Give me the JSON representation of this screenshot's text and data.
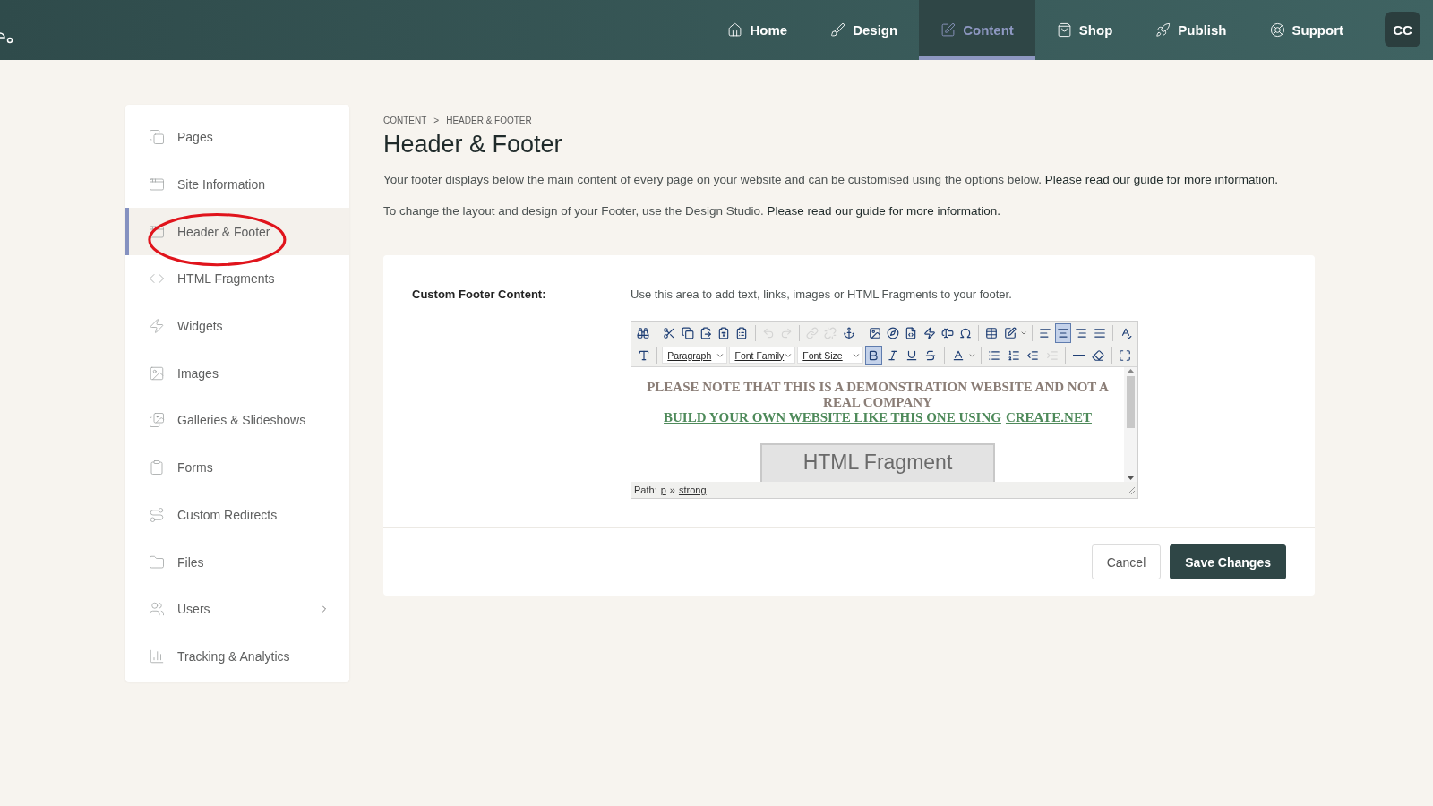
{
  "nav": {
    "items": [
      {
        "label": "Home",
        "selected": false
      },
      {
        "label": "Design",
        "selected": false
      },
      {
        "label": "Content",
        "selected": true
      },
      {
        "label": "Shop",
        "selected": false
      },
      {
        "label": "Publish",
        "selected": false
      },
      {
        "label": "Support",
        "selected": false
      }
    ],
    "avatar": "CC"
  },
  "sidebar": {
    "items": [
      {
        "label": "Pages",
        "selected": false,
        "expandable": false
      },
      {
        "label": "Site Information",
        "selected": false,
        "expandable": false
      },
      {
        "label": "Header & Footer",
        "selected": true,
        "expandable": false
      },
      {
        "label": "HTML Fragments",
        "selected": false,
        "expandable": false
      },
      {
        "label": "Widgets",
        "selected": false,
        "expandable": false
      },
      {
        "label": "Images",
        "selected": false,
        "expandable": false
      },
      {
        "label": "Galleries & Slideshows",
        "selected": false,
        "expandable": false
      },
      {
        "label": "Forms",
        "selected": false,
        "expandable": false
      },
      {
        "label": "Custom Redirects",
        "selected": false,
        "expandable": false
      },
      {
        "label": "Files",
        "selected": false,
        "expandable": false
      },
      {
        "label": "Users",
        "selected": false,
        "expandable": true
      },
      {
        "label": "Tracking & Analytics",
        "selected": false,
        "expandable": false
      }
    ]
  },
  "breadcrumb": [
    "CONTENT",
    ">",
    "HEADER & FOOTER"
  ],
  "title": "Header & Footer",
  "intro": [
    {
      "text": "Your footer displays below the main content of every page on your website and can be customised using the options below.",
      "link": "Please read our guide for more information."
    },
    {
      "text": "To change the layout and design of your Footer, use the Design Studio.",
      "link": "Please read our guide for more information."
    }
  ],
  "form": {
    "label": "Custom Footer Content:",
    "help": "Use this area to add text, links, images or HTML Fragments to your footer.",
    "editor": {
      "toolbar": [
        {
          "items": [
            {
              "kind": "button",
              "selected": false,
              "disabled": false
            },
            {
              "kind": "separator"
            },
            {
              "kind": "button",
              "selected": false,
              "disabled": false
            },
            {
              "kind": "button",
              "selected": false,
              "disabled": false
            },
            {
              "kind": "button",
              "selected": false,
              "disabled": false
            },
            {
              "kind": "button",
              "selected": false,
              "disabled": false
            },
            {
              "kind": "button",
              "selected": false,
              "disabled": false
            },
            {
              "kind": "separator"
            },
            {
              "kind": "button",
              "selected": false,
              "disabled": true
            },
            {
              "kind": "button",
              "selected": false,
              "disabled": true
            },
            {
              "kind": "separator"
            },
            {
              "kind": "button",
              "selected": false,
              "disabled": true
            },
            {
              "kind": "button",
              "selected": false,
              "disabled": true
            },
            {
              "kind": "button",
              "selected": false,
              "disabled": false
            },
            {
              "kind": "separator"
            },
            {
              "kind": "button",
              "selected": false,
              "disabled": false
            },
            {
              "kind": "button",
              "selected": false,
              "disabled": false
            },
            {
              "kind": "button",
              "selected": false,
              "disabled": false
            },
            {
              "kind": "button",
              "selected": false,
              "disabled": false
            },
            {
              "kind": "button",
              "selected": false,
              "disabled": false
            },
            {
              "kind": "button",
              "selected": false,
              "disabled": false
            },
            {
              "kind": "separator"
            },
            {
              "kind": "button",
              "selected": false,
              "disabled": false
            },
            {
              "kind": "button",
              "selected": false,
              "disabled": false
            },
            {
              "kind": "separator"
            },
            {
              "kind": "button",
              "selected": false,
              "disabled": false
            },
            {
              "kind": "button",
              "selected": true,
              "disabled": false
            },
            {
              "kind": "button",
              "selected": false,
              "disabled": false
            },
            {
              "kind": "button",
              "selected": false,
              "disabled": false
            },
            {
              "kind": "separator"
            },
            {
              "kind": "button",
              "selected": false,
              "disabled": false
            }
          ]
        },
        {
          "items": [
            {
              "kind": "button",
              "selected": false,
              "disabled": false
            },
            {
              "kind": "separator"
            },
            {
              "kind": "select",
              "label": "Paragraph"
            },
            {
              "kind": "select",
              "label": "Font Family"
            },
            {
              "kind": "select",
              "label": "Font Size"
            },
            {
              "kind": "button",
              "selected": true,
              "disabled": false
            },
            {
              "kind": "button",
              "selected": false,
              "disabled": false
            },
            {
              "kind": "button",
              "selected": false,
              "disabled": false
            },
            {
              "kind": "button",
              "selected": false,
              "disabled": false
            },
            {
              "kind": "separator"
            },
            {
              "kind": "button",
              "selected": false,
              "disabled": false
            },
            {
              "kind": "separator"
            },
            {
              "kind": "button",
              "selected": false,
              "disabled": false
            },
            {
              "kind": "button",
              "selected": false,
              "disabled": false
            },
            {
              "kind": "button",
              "selected": false,
              "disabled": false
            },
            {
              "kind": "button",
              "selected": false,
              "disabled": true
            },
            {
              "kind": "separator"
            },
            {
              "kind": "button",
              "selected": false,
              "disabled": false
            },
            {
              "kind": "button",
              "selected": false,
              "disabled": false
            },
            {
              "kind": "separator"
            },
            {
              "kind": "button",
              "selected": false,
              "disabled": false
            }
          ]
        }
      ],
      "notice": "PLEASE NOTE THAT THIS IS A DEMONSTRATION WEBSITE AND NOT A REAL COMPANY",
      "links": [
        "BUILD YOUR OWN WEBSITE LIKE THIS ONE USING",
        "CREATE.NET"
      ],
      "fragment": "HTML Fragment",
      "path": {
        "label": "Path:",
        "items": [
          "p",
          "strong"
        ],
        "separator": "»"
      }
    }
  },
  "buttons": [
    {
      "label": "Cancel",
      "kind": "secondary"
    },
    {
      "label": "Save Changes",
      "kind": "primary"
    }
  ]
}
